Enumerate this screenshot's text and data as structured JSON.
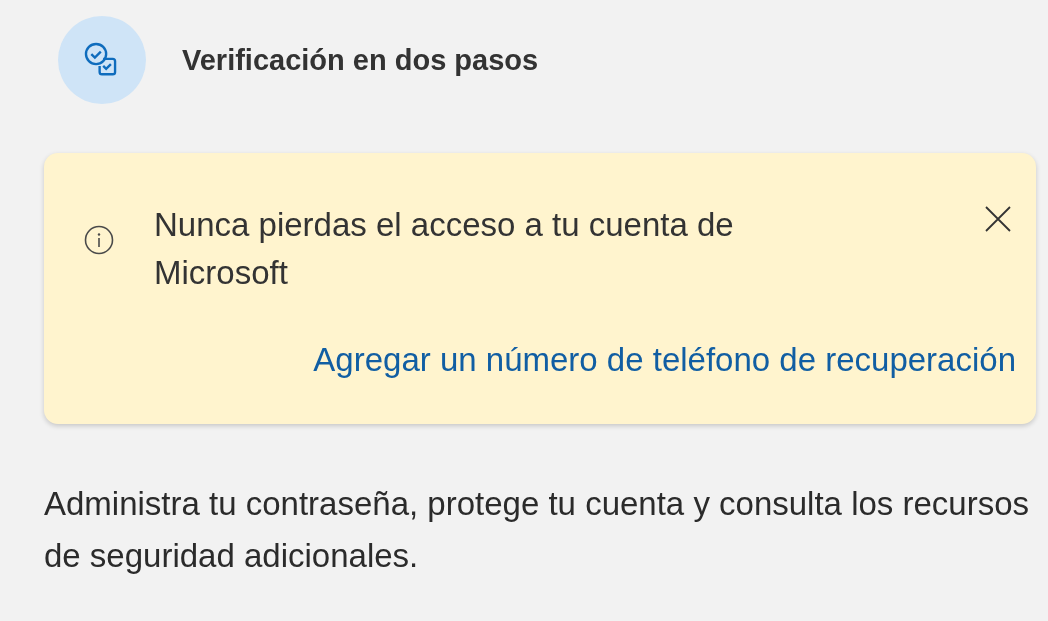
{
  "header": {
    "title": "Verificación en dos pasos"
  },
  "notice": {
    "message": "Nunca pierdas el acceso a tu cuenta de Microsoft",
    "link": "Agregar un número de teléfono de recuperación",
    "dismissible": true
  },
  "description": "Administra tu contraseña, protege tu cuenta y consulta los recursos de seguridad adicionales."
}
